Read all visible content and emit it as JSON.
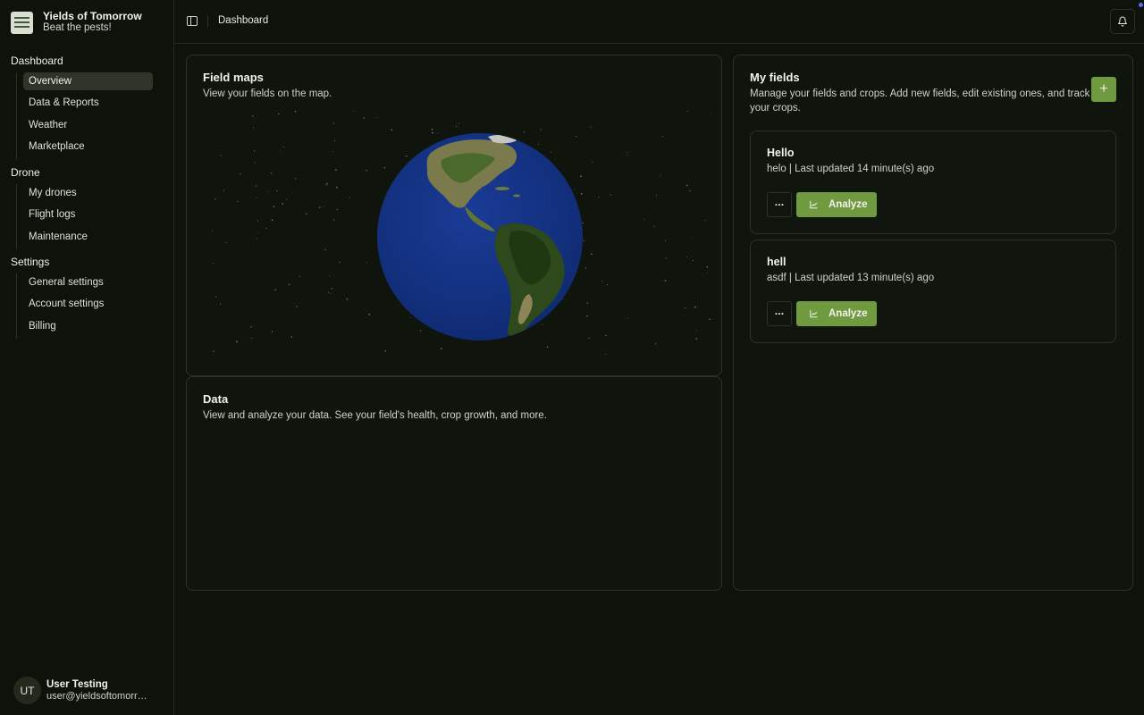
{
  "app": {
    "name": "Yields of Tomorrow",
    "tagline": "Beat the pests!"
  },
  "sidebar": {
    "groups": [
      {
        "label": "Dashboard",
        "items": [
          "Overview",
          "Data & Reports",
          "Weather",
          "Marketplace"
        ]
      },
      {
        "label": "Drone",
        "items": [
          "My drones",
          "Flight logs",
          "Maintenance"
        ]
      },
      {
        "label": "Settings",
        "items": [
          "General settings",
          "Account settings",
          "Billing"
        ]
      }
    ],
    "active_item": "Overview"
  },
  "user": {
    "initials": "UT",
    "name": "User Testing",
    "email": "user@yieldsoftomorrow.com"
  },
  "header": {
    "breadcrumb": "Dashboard"
  },
  "field_maps": {
    "title": "Field maps",
    "description": "View your fields on the map."
  },
  "data_card": {
    "title": "Data",
    "description": "View and analyze your data. See your field's health, crop growth, and more."
  },
  "my_fields": {
    "title": "My fields",
    "description_line1": "Manage your fields and crops. Add new fields, edit existing ones, and track",
    "description_line2": "your crops.",
    "add_label": "+",
    "analyze_label": "Analyze",
    "more_label": "···",
    "fields": [
      {
        "name": "Hello",
        "meta": "helo | Last updated 14 minute(s) ago"
      },
      {
        "name": "hell",
        "meta": "asdf | Last updated 13 minute(s) ago"
      }
    ]
  },
  "colors": {
    "accent": "#6f9a3f",
    "background": "#0d120a",
    "notification_dot": "#5b6cf0"
  },
  "icons": [
    "sidebar-toggle-icon",
    "bell-icon",
    "chart-line-icon",
    "plus-icon",
    "ellipsis-icon",
    "globe-icon",
    "logo-icon"
  ]
}
